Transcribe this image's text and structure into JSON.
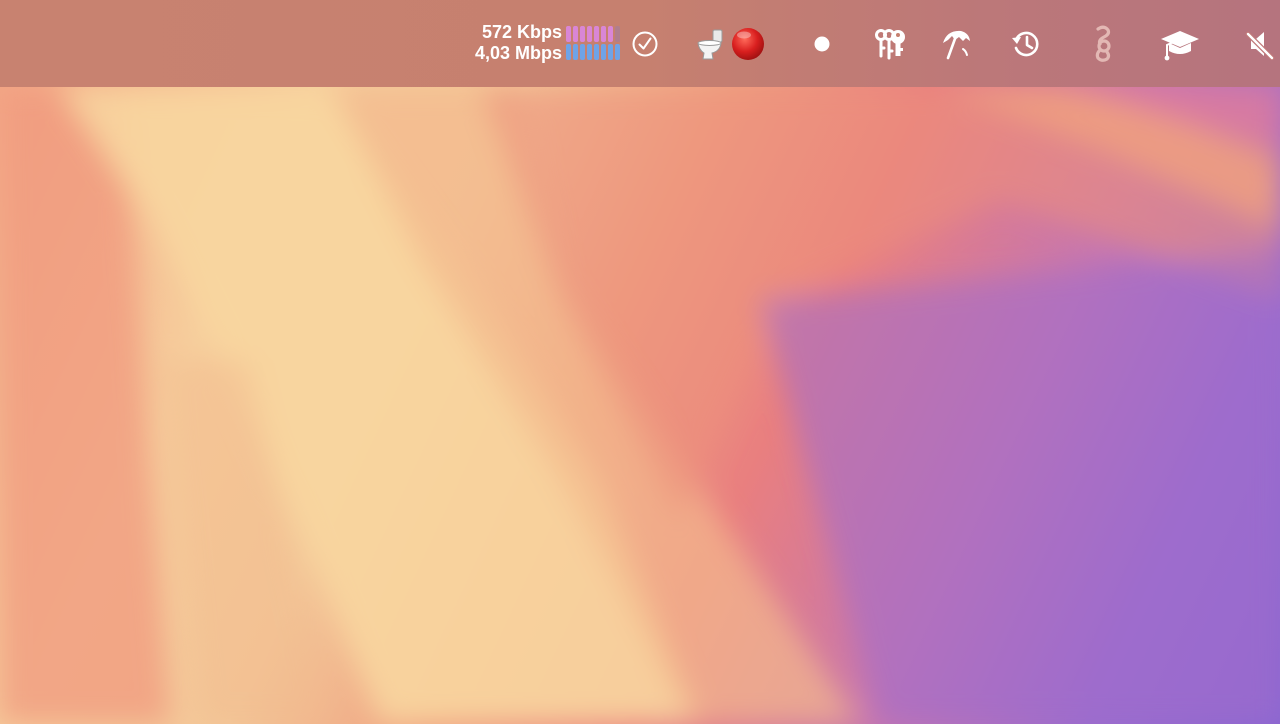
{
  "menubar": {
    "network": {
      "upload_speed": "572 Kbps",
      "download_speed": "4,03 Mbps",
      "upload_bars": {
        "total": 8,
        "active": 7,
        "color": "#d986d6",
        "inactive_color": "#b07e8c"
      },
      "download_bars": {
        "total": 8,
        "active": 8,
        "color": "#6fa3e8"
      }
    },
    "items": [
      {
        "name": "checkmark-circle-icon"
      },
      {
        "name": "toilet-icon"
      },
      {
        "name": "red-circle-icon"
      },
      {
        "name": "white-dot-icon"
      },
      {
        "name": "keys-icon"
      },
      {
        "name": "beach-umbrella-icon"
      },
      {
        "name": "time-machine-icon"
      },
      {
        "name": "chain-link-icon"
      },
      {
        "name": "graduation-cap-icon"
      },
      {
        "name": "speaker-muted-icon"
      }
    ]
  },
  "colors": {
    "menubar": "#c6806f",
    "icon": "#ffffff",
    "red_dot": "#d91f1f"
  }
}
